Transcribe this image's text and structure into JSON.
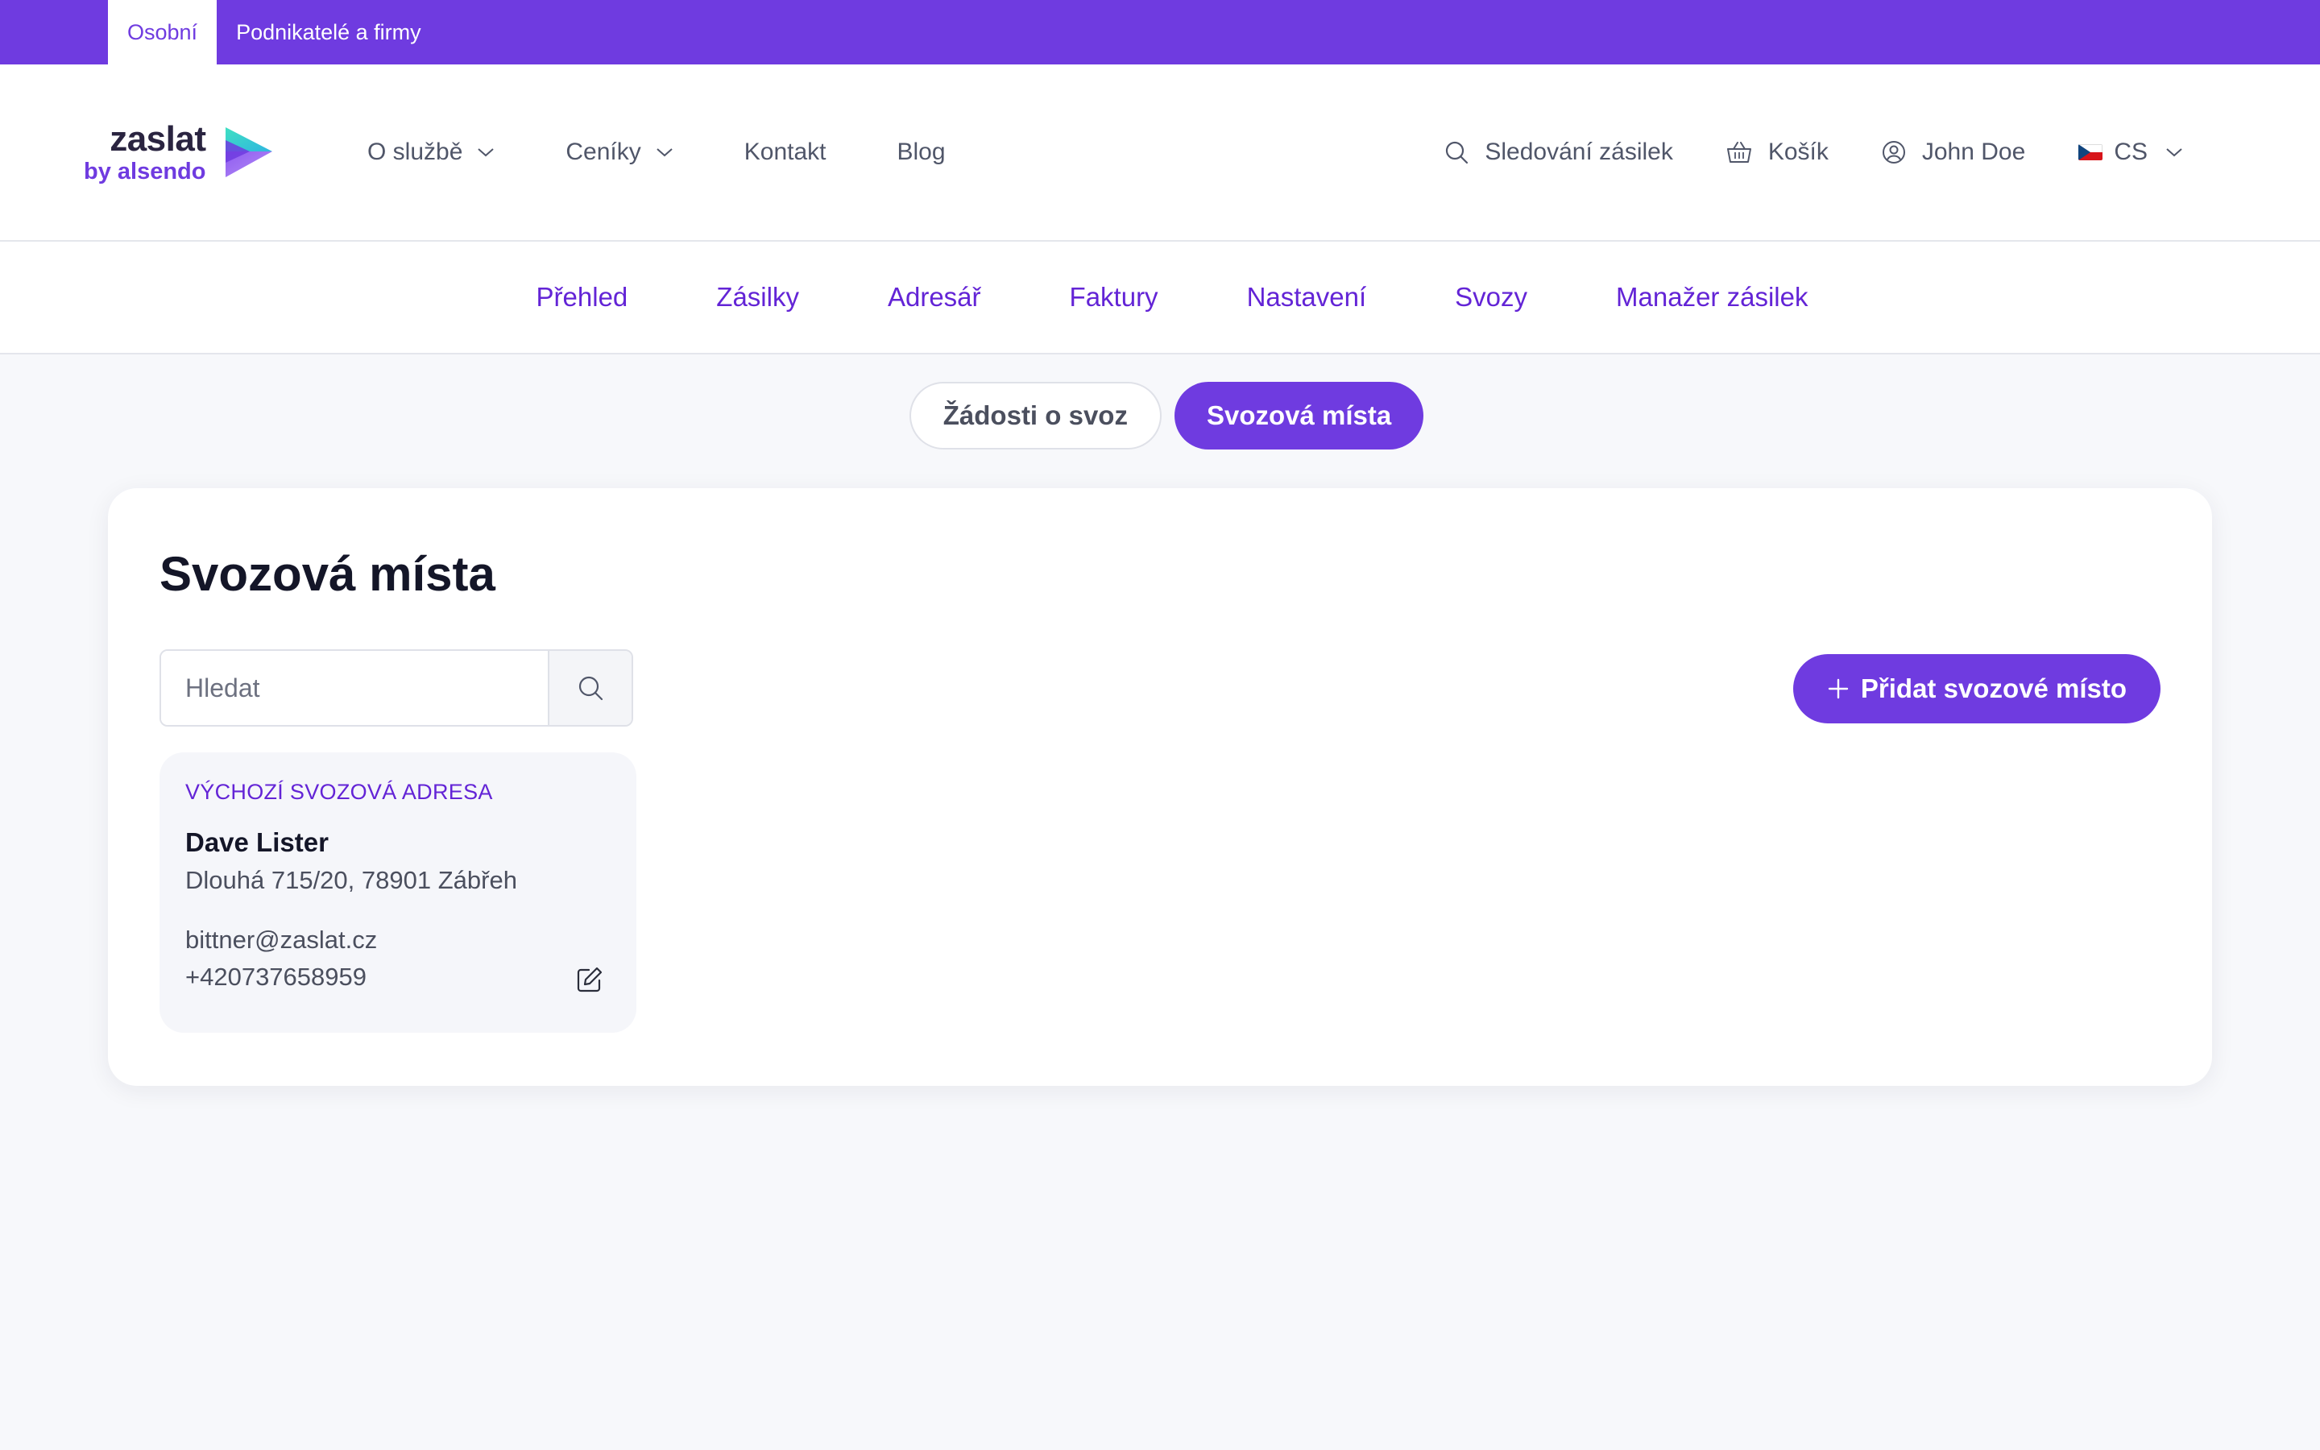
{
  "topbar": {
    "segments": [
      "Osobní",
      "Podnikatelé a firmy"
    ]
  },
  "header": {
    "logo": {
      "name": "zaslat",
      "tagline": "by alsendo"
    },
    "nav": [
      {
        "label": "O službě",
        "icon": "chevron-down-icon"
      },
      {
        "label": "Ceníky",
        "icon": "chevron-down-icon"
      },
      {
        "label": "Kontakt"
      },
      {
        "label": "Blog"
      }
    ],
    "util": {
      "tracking": "Sledování zásilek",
      "cart": "Košík",
      "user": "John Doe",
      "language": "CS"
    }
  },
  "subnav": [
    "Přehled",
    "Zásilky",
    "Adresář",
    "Faktury",
    "Nastavení",
    "Svozy",
    "Manažer zásilek"
  ],
  "pills": {
    "requests": "Žádosti o svoz",
    "places": "Svozová místa",
    "active": "places"
  },
  "main": {
    "title": "Svozová místa",
    "search": {
      "placeholder": "Hledat",
      "value": ""
    },
    "add_button": "Přidat svozové místo",
    "address": {
      "label": "VÝCHOZÍ SVOZOVÁ ADRESA",
      "name": "Dave Lister",
      "street": "Dlouhá 715/20, 78901 Zábřeh",
      "email": "bittner@zaslat.cz",
      "phone": "+420737658959"
    }
  },
  "colors": {
    "brand": "#6f3be0",
    "link": "#6324d6",
    "logo_teal": "#3fe0c2",
    "page_bg": "#f7f8fb"
  }
}
